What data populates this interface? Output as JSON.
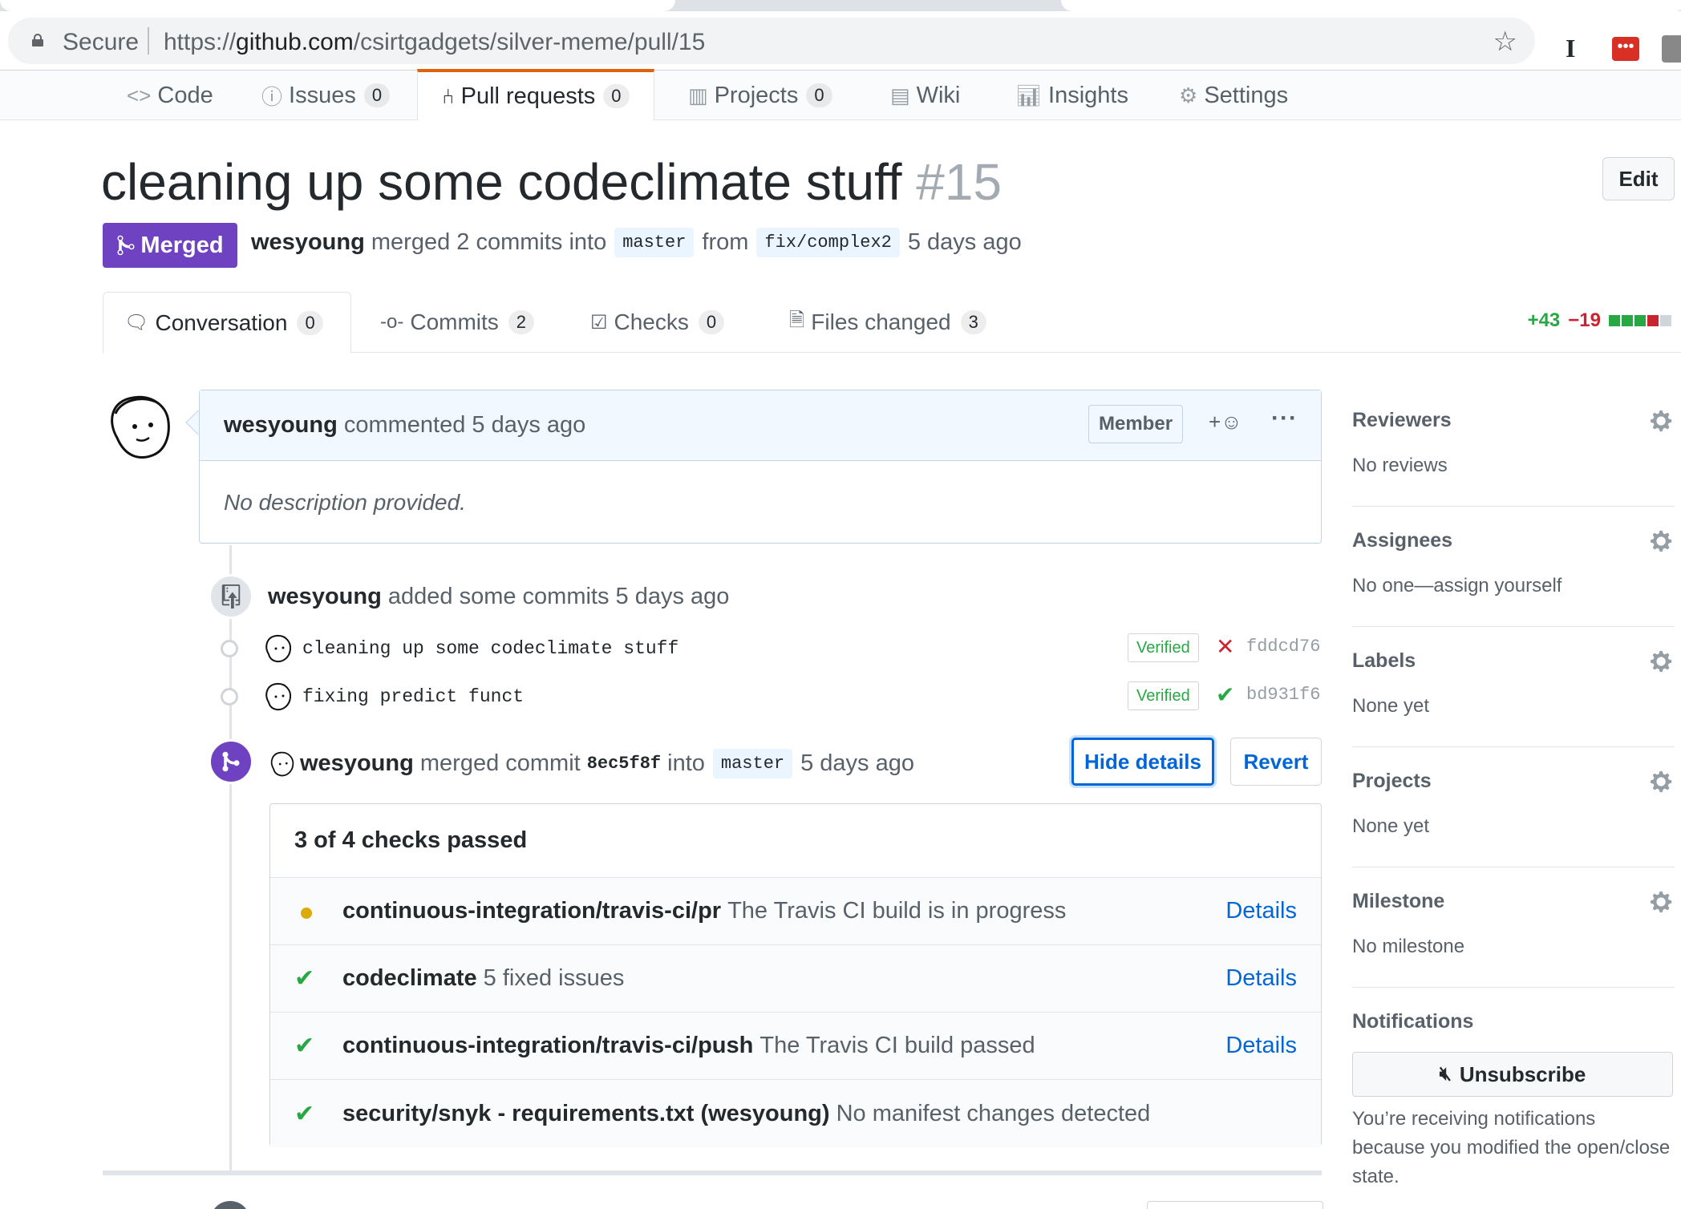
{
  "browser": {
    "secure_label": "Secure",
    "url_prefix": "https://",
    "url_host": "github.com",
    "url_path": "/csirtgadgets/silver-meme/pull/15"
  },
  "repo_nav": {
    "tabs": [
      {
        "label": "Code",
        "count": null
      },
      {
        "label": "Issues",
        "count": "0"
      },
      {
        "label": "Pull requests",
        "count": "0"
      },
      {
        "label": "Projects",
        "count": "0"
      },
      {
        "label": "Wiki",
        "count": null
      },
      {
        "label": "Insights",
        "count": null
      },
      {
        "label": "Settings",
        "count": null
      }
    ]
  },
  "pr": {
    "title": "cleaning up some codeclimate stuff",
    "number": "#15",
    "edit_label": "Edit",
    "state": "Merged",
    "author": "wesyoung",
    "meta_merged": "merged 2 commits into",
    "base_branch": "master",
    "meta_from": "from",
    "head_branch": "fix/complex2",
    "when": "5 days ago"
  },
  "pr_tabs": [
    {
      "label": "Conversation",
      "count": "0"
    },
    {
      "label": "Commits",
      "count": "2"
    },
    {
      "label": "Checks",
      "count": "0"
    },
    {
      "label": "Files changed",
      "count": "3"
    }
  ],
  "diffstat": {
    "additions": "+43",
    "deletions": "−19",
    "colors": [
      "#28a745",
      "#28a745",
      "#28a745",
      "#cb2431",
      "#d1d5da"
    ]
  },
  "comment": {
    "author": "wesyoung",
    "action": "commented 5 days ago",
    "role_badge": "Member",
    "reaction": "+☺",
    "more": "···",
    "body": "No description provided."
  },
  "commits_event": {
    "author": "wesyoung",
    "text": "added some commits 5 days ago",
    "commits": [
      {
        "message": "cleaning up some codeclimate stuff",
        "verified": "Verified",
        "status": "✕",
        "status_color": "#cb2431",
        "sha": "fddcd76"
      },
      {
        "message": "fixing predict funct",
        "verified": "Verified",
        "status": "✔",
        "status_color": "#28a745",
        "sha": "bd931f6"
      }
    ]
  },
  "merge_event": {
    "author": "wesyoung",
    "text_merged": "merged commit",
    "sha": "8ec5f8f",
    "into": "into",
    "branch": "master",
    "when": "5 days ago",
    "hide_label": "Hide details",
    "revert_label": "Revert"
  },
  "checks": {
    "summary": "3 of 4 checks passed",
    "rows": [
      {
        "status": "pending",
        "name": "continuous-integration/travis-ci/pr",
        "desc": "The Travis CI build is in progress",
        "details": "Details"
      },
      {
        "status": "success",
        "name": "codeclimate",
        "desc": "5 fixed issues",
        "details": "Details"
      },
      {
        "status": "success",
        "name": "continuous-integration/travis-ci/push",
        "desc": "The Travis CI build passed",
        "details": "Details"
      },
      {
        "status": "success",
        "name": "security/snyk - requirements.txt (wesyoung)",
        "desc": "No manifest changes detected",
        "details": ""
      }
    ]
  },
  "sidebar": {
    "reviewers": {
      "title": "Reviewers",
      "value": "No reviews"
    },
    "assignees": {
      "title": "Assignees",
      "value": "No one—assign yourself"
    },
    "labels": {
      "title": "Labels",
      "value": "None yet"
    },
    "projects": {
      "title": "Projects",
      "value": "None yet"
    },
    "milestone": {
      "title": "Milestone",
      "value": "No milestone"
    },
    "notifications": {
      "title": "Notifications",
      "button": "Unsubscribe",
      "text": "You’re receiving notifications because you modified the open/close state."
    }
  }
}
